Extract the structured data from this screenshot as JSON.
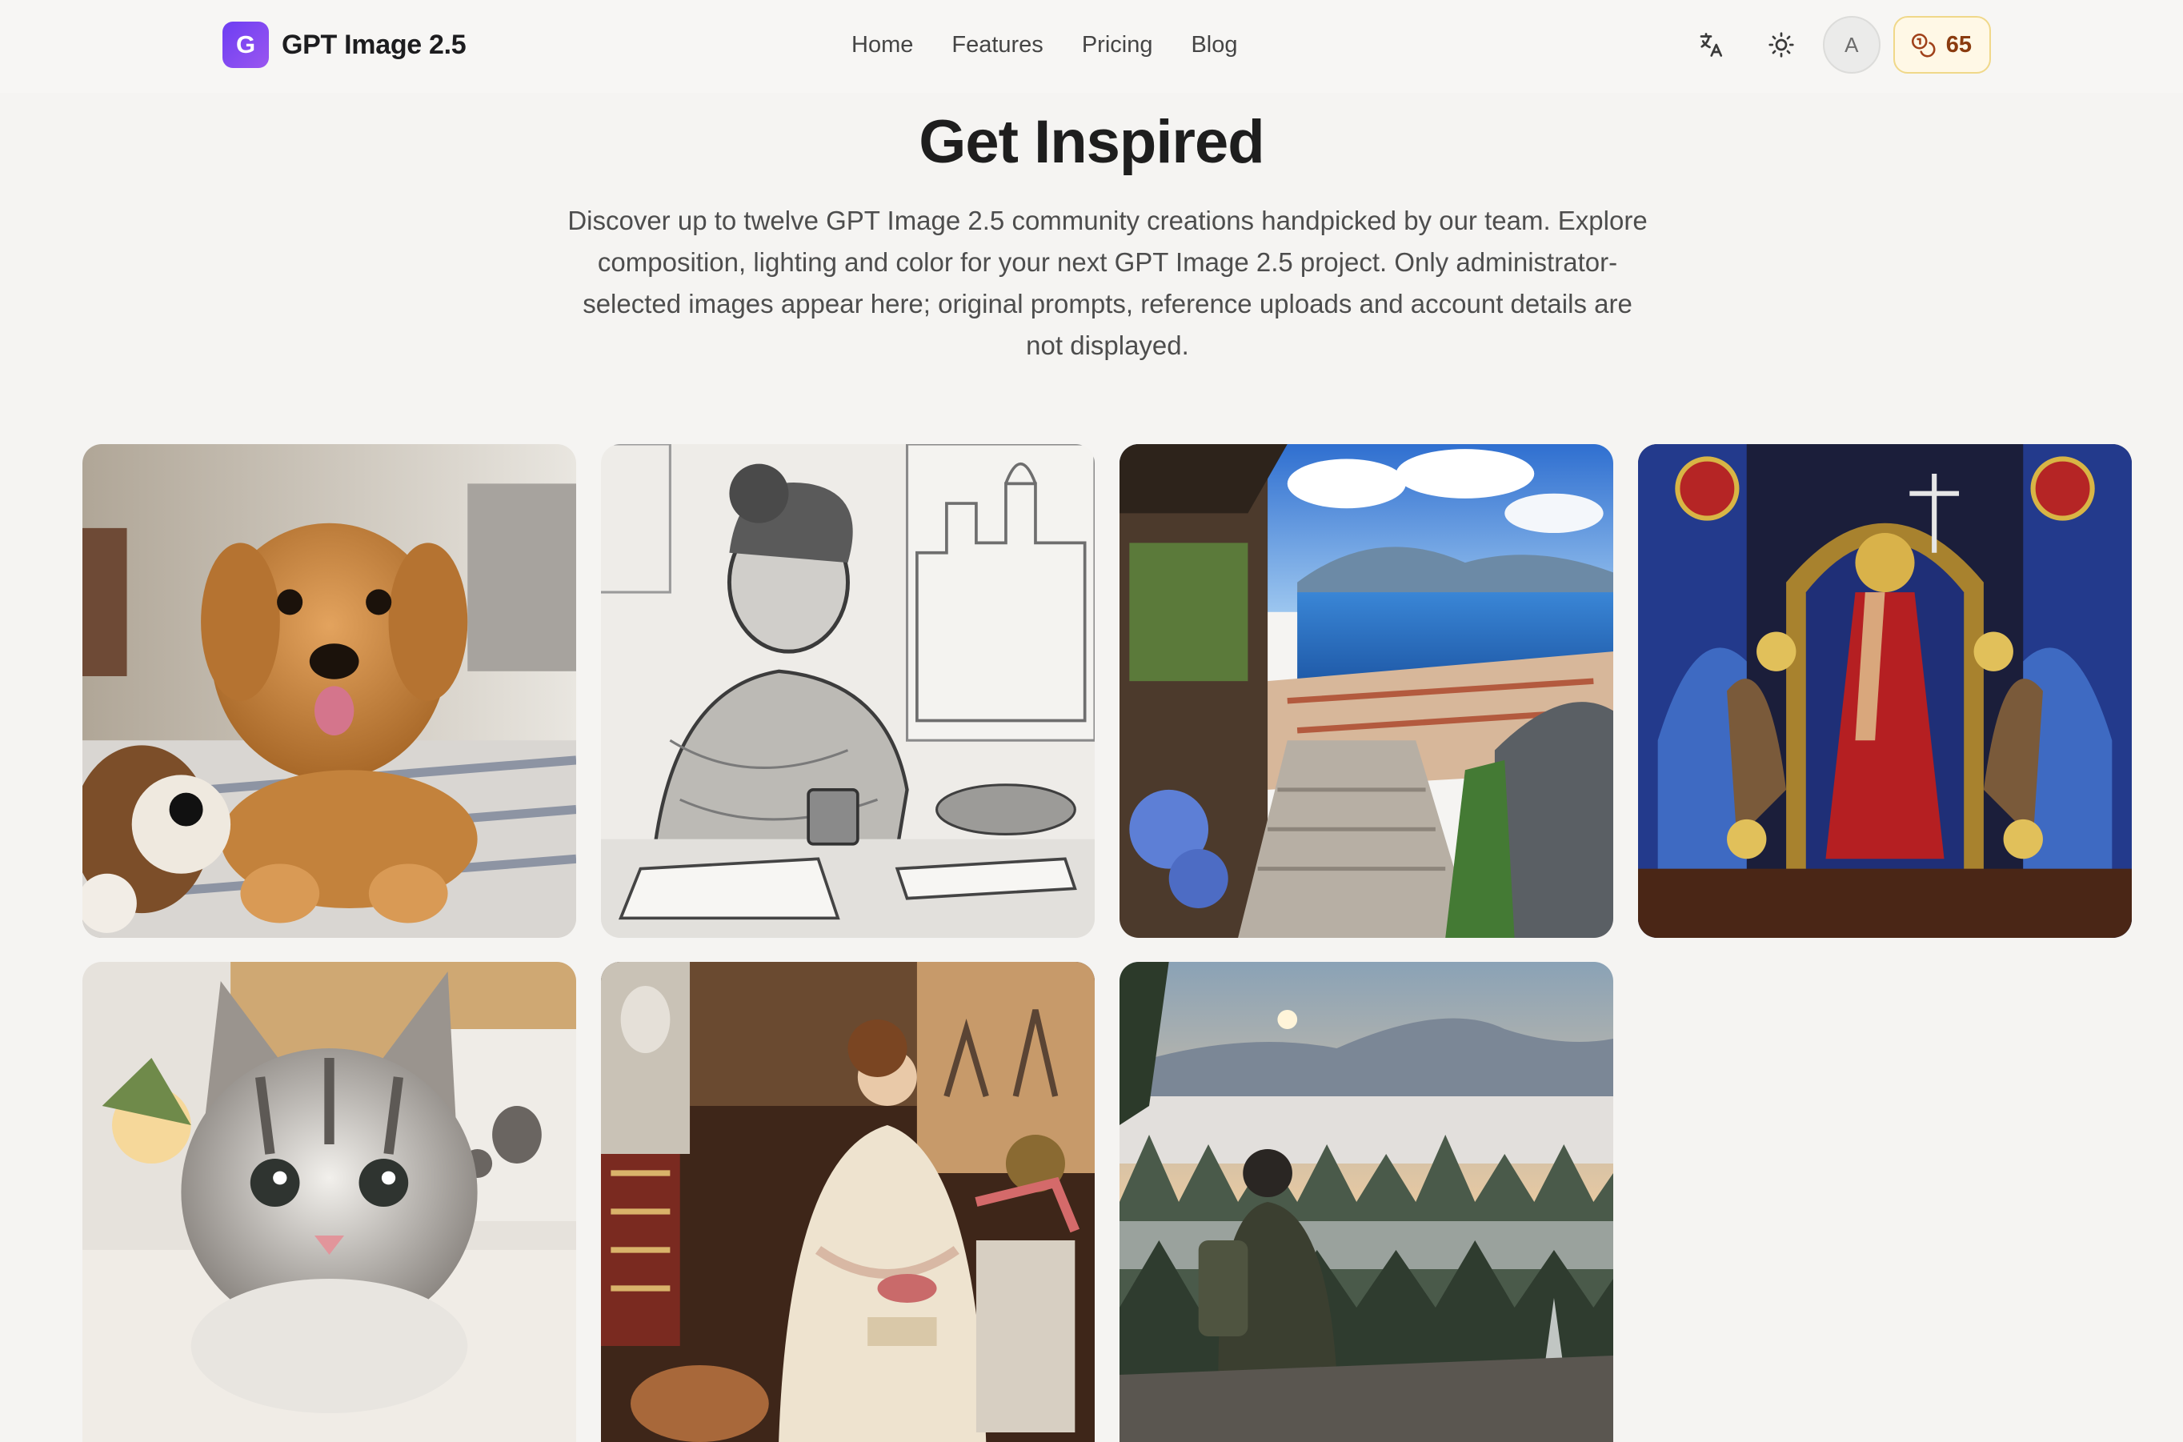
{
  "header": {
    "brand": {
      "logo_letter": "G",
      "name": "GPT Image 2.5"
    },
    "nav": [
      {
        "label": "Home"
      },
      {
        "label": "Features"
      },
      {
        "label": "Pricing"
      },
      {
        "label": "Blog"
      }
    ],
    "actions": {
      "language_icon": "translate-icon",
      "theme_icon": "sun-icon",
      "avatar_initial": "A",
      "credits_icon": "coins-icon",
      "credits_value": "65"
    }
  },
  "hero": {
    "title": "Get Inspired",
    "description": "Discover up to twelve GPT Image 2.5 community creations handpicked by our team. Explore composition, lighting and color for your next GPT Image 2.5 project. Only administrator-selected images appear here; original prompts, reference uploads and account details are not displayed."
  },
  "gallery": [
    {
      "subject": "golden retriever puppy on rug with plush toy"
    },
    {
      "subject": "pencil sketch of woman by window with cat and coffee"
    },
    {
      "subject": "stone staircase village overlooking coastal bay"
    },
    {
      "subject": "stained glass religious figures with angels"
    },
    {
      "subject": "tabby kitten on fluffy blanket"
    },
    {
      "subject": "victorian woman reading in ornate library"
    },
    {
      "subject": "hiker sitting on rock above misty forest at sunrise"
    }
  ],
  "colors": {
    "accent": "#7c4df2",
    "credits_bg": "#fff8e6",
    "credits_text": "#8a3b0f",
    "page_bg": "#f5f4f2"
  }
}
